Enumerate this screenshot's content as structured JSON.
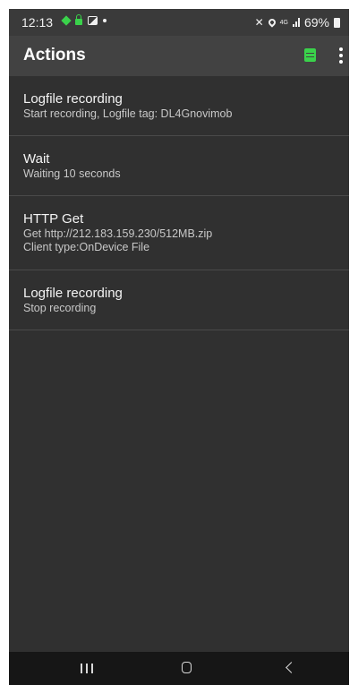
{
  "status_bar": {
    "time": "12:13",
    "battery_percent": "69%",
    "network_label": "4G",
    "left_icons": [
      "green-diamond-icon",
      "lock-icon",
      "image-icon",
      "dot-icon"
    ],
    "right_icons": [
      "mute-icon",
      "location-icon",
      "4g-icon",
      "signal-icon",
      "battery-icon"
    ]
  },
  "app_bar": {
    "title": "Actions",
    "accent_color": "#3ad24b"
  },
  "actions": [
    {
      "title": "Logfile recording",
      "lines": [
        "Start recording, Logfile tag: DL4Gnovimob"
      ]
    },
    {
      "title": "Wait",
      "lines": [
        "Waiting 10 seconds"
      ]
    },
    {
      "title": "HTTP Get",
      "lines": [
        "Get http://212.183.159.230/512MB.zip",
        "Client type:OnDevice File"
      ]
    },
    {
      "title": "Logfile recording",
      "lines": [
        "Stop recording"
      ]
    }
  ],
  "nav_bar": {
    "buttons": [
      "recents-icon",
      "home-icon",
      "back-icon"
    ]
  },
  "colors": {
    "background": "#303030",
    "app_bar": "#424242",
    "status_bar": "#3a3a3a",
    "nav_bar": "#161616"
  }
}
